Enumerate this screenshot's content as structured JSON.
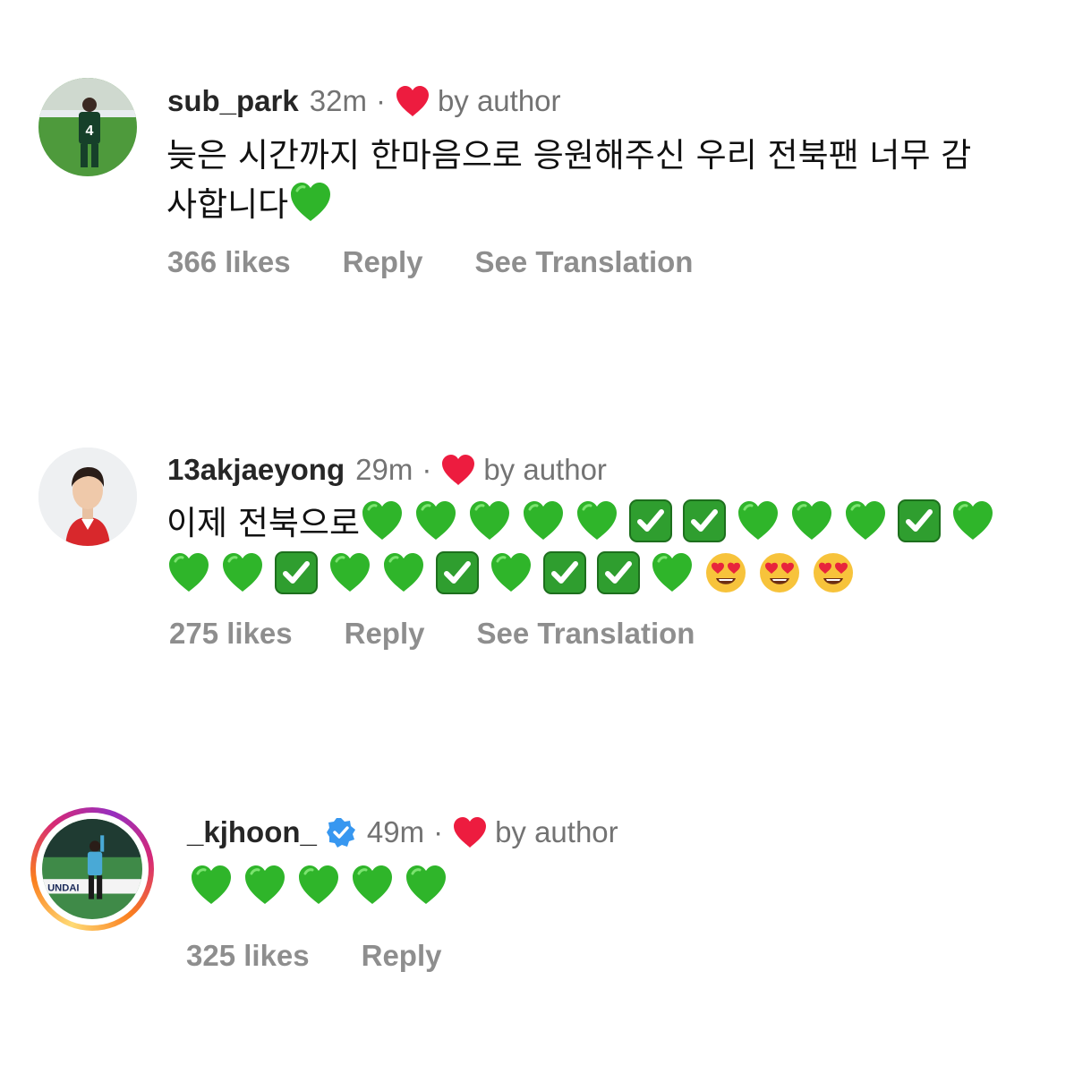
{
  "comments": [
    {
      "username": "sub_park",
      "time": "32m",
      "liked_by_author": "by author",
      "text_lines": [
        "늦은 시간까지 한마음으로 응원해주신 우리 전북팬 너무 감",
        "사합니다"
      ],
      "emoji_line2": [
        "green-heart"
      ],
      "likes": "366 likes",
      "reply": "Reply",
      "translate": "See Translation"
    },
    {
      "username": "13akjaeyong",
      "time": "29m",
      "liked_by_author": "by author",
      "text_prefix": "이제 전북으로",
      "emoji_line1": [
        "green-heart",
        "green-heart",
        "green-heart",
        "green-heart",
        "green-heart",
        "check-box",
        "check-box",
        "green-heart",
        "green-heart",
        "green-heart",
        "check-box",
        "green-heart"
      ],
      "emoji_line2": [
        "green-heart",
        "green-heart",
        "check-box",
        "green-heart",
        "green-heart",
        "check-box",
        "green-heart",
        "check-box",
        "check-box",
        "green-heart",
        "heart-eyes",
        "heart-eyes",
        "heart-eyes"
      ],
      "likes": "275 likes",
      "reply": "Reply",
      "translate": "See Translation"
    },
    {
      "username": "_kjhoon_",
      "verified": true,
      "time": "49m",
      "liked_by_author": "by author",
      "emoji_line1": [
        "green-heart",
        "green-heart",
        "green-heart",
        "green-heart",
        "green-heart"
      ],
      "likes": "325 likes",
      "reply": "Reply",
      "avatar_banner_text": "UNDAI"
    }
  ],
  "colors": {
    "heart_red": "#ed1c3f",
    "green_heart": "#2fb52a",
    "check_green": "#2f9e2f",
    "verified_blue": "#3797f0",
    "muted": "#737373"
  }
}
